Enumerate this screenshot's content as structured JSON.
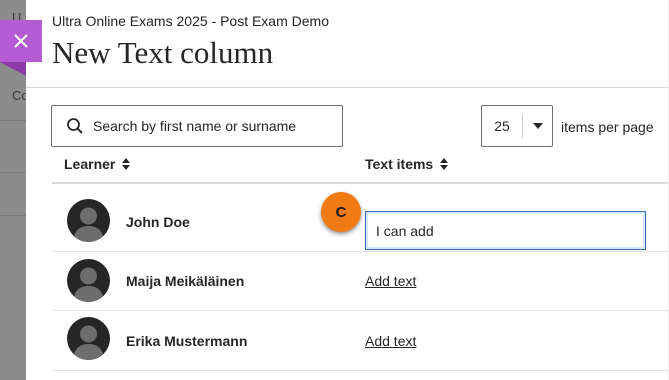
{
  "background": {
    "text_top": "U",
    "text_mid": "Co"
  },
  "panel": {
    "breadcrumb": "Ultra Online Exams 2025 - Post Exam Demo",
    "title": "New Text column",
    "close_icon": "close-icon",
    "accent_color": "#b55cd4"
  },
  "search": {
    "placeholder": "Search by first name or surname",
    "value": "",
    "icon": "search-icon"
  },
  "pagination": {
    "page_size": "25",
    "options": [
      "25"
    ],
    "label": "items per page"
  },
  "table": {
    "columns": [
      {
        "label": "Learner",
        "icon": "sort-icon"
      },
      {
        "label": "Text items",
        "icon": "sort-icon"
      }
    ],
    "rows": [
      {
        "name": "John Doe",
        "text_value": "I can add",
        "editing": true,
        "add_text_label": ""
      },
      {
        "name": "Maija Meikäläinen",
        "text_value": "",
        "editing": false,
        "add_text_label": "Add text"
      },
      {
        "name": "Erika Mustermann",
        "text_value": "",
        "editing": false,
        "add_text_label": "Add text"
      }
    ]
  },
  "callout": {
    "label": "C",
    "color": "#f07a14"
  }
}
